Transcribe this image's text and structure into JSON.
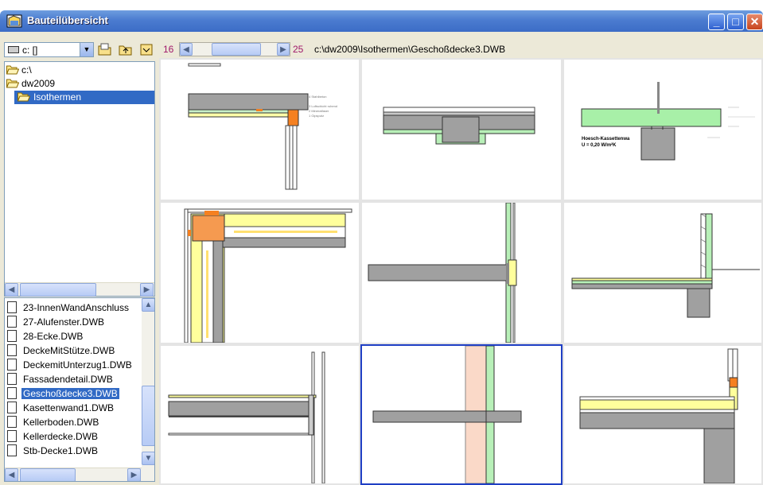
{
  "window": {
    "title": "Bauteilübersicht",
    "minimize": "_",
    "maximize": "□",
    "close": "✕"
  },
  "drive": {
    "value": "c: []",
    "icon": "drive-icon"
  },
  "toolbar_icons": [
    "folder-open-icon",
    "folder-up-icon",
    "folder-down-icon"
  ],
  "tree": {
    "items": [
      {
        "label": "c:\\",
        "icon": "folder-open-icon"
      },
      {
        "label": "dw2009",
        "icon": "folder-open-icon"
      },
      {
        "label": "Isothermen",
        "icon": "folder-open-icon",
        "selected": true
      }
    ]
  },
  "files": {
    "items": [
      "23-InnenWandAnschluss",
      "27-Alufenster.DWB",
      "28-Ecke.DWB",
      "DeckeMitStütze.DWB",
      "DeckemitUnterzug1.DWB",
      "Fassadendetail.DWB",
      "Geschoßdecke3.DWB",
      "Kasettenwand1.DWB",
      "Kellerboden.DWB",
      "Kellerdecke.DWB",
      "Stb-Decke1.DWB"
    ],
    "selected_index": 6
  },
  "nav": {
    "start": "16",
    "end": "25",
    "path": "c:\\dw2009\\Isothermen\\Geschoßdecke3.DWB"
  },
  "thumb_texts": {
    "t1_note1": "4 Stahlbeton",
    "t1_note2": "3 Luftschicht ruhend",
    "t1_note3": "2 Mineralfaser",
    "t1_note4": "1 Gipsputz",
    "t3_caption1": "Hoesch-Kassettenwa",
    "t3_caption2": "U = 0,20 W/m²K"
  }
}
